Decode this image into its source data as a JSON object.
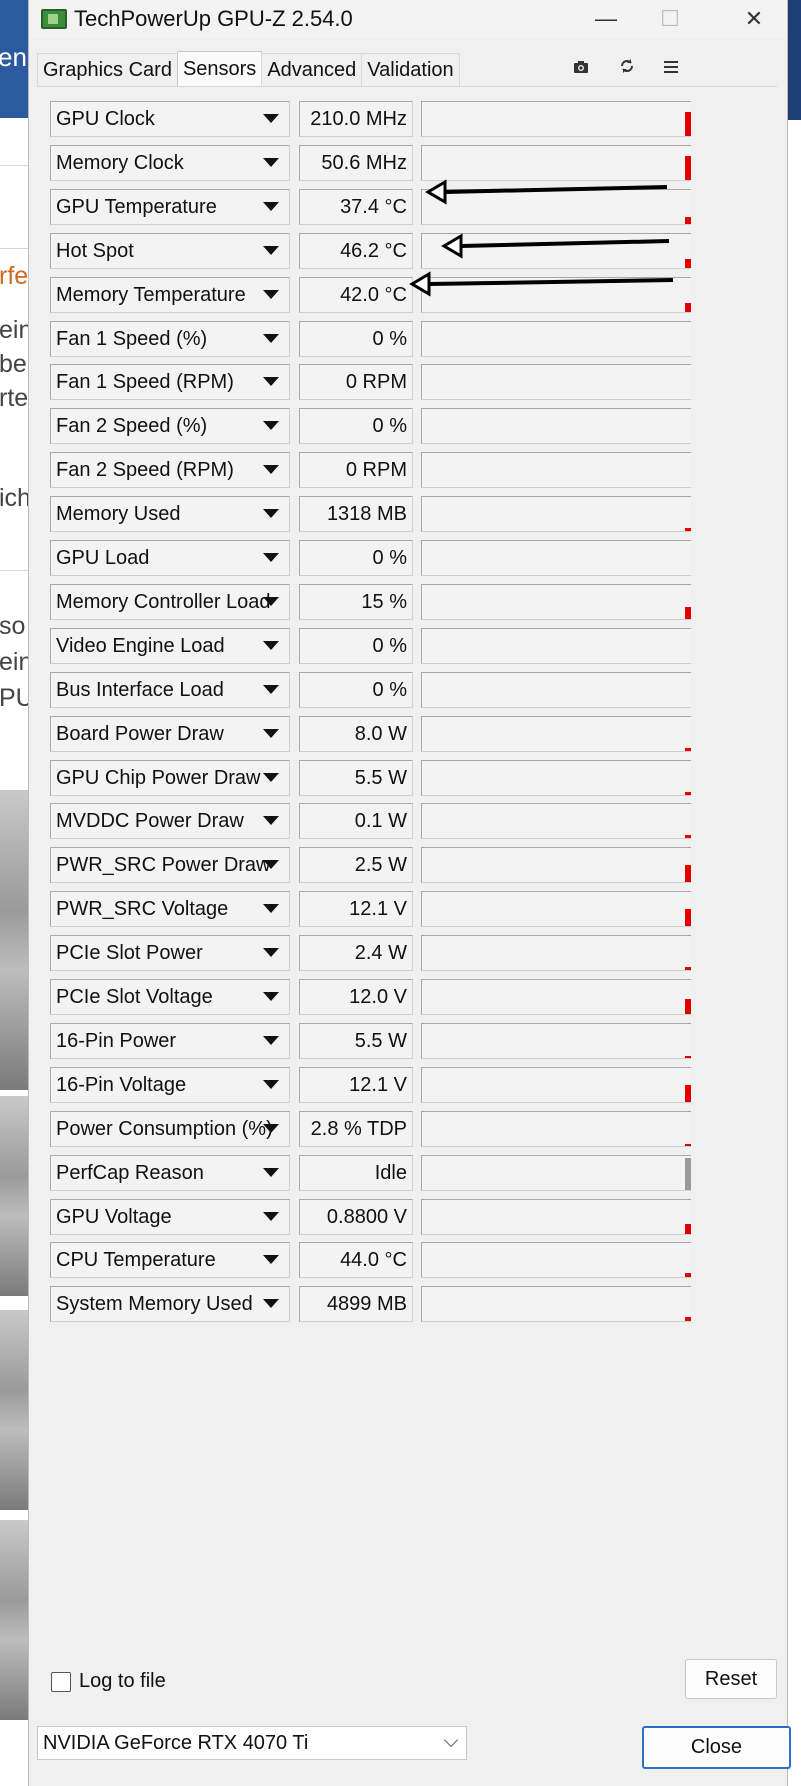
{
  "window": {
    "title": "TechPowerUp GPU-Z 2.54.0",
    "minimize": "—",
    "maximize": "☐",
    "close": "✕"
  },
  "tabs": [
    "Graphics Card",
    "Sensors",
    "Advanced",
    "Validation"
  ],
  "active_tab": "Sensors",
  "toolbar_icons": [
    "camera-icon",
    "refresh-icon",
    "menu-icon"
  ],
  "sensors": [
    {
      "name": "GPU Clock",
      "value": "210.0 MHz",
      "level": 0.7
    },
    {
      "name": "Memory Clock",
      "value": "50.6 MHz",
      "level": 0.7
    },
    {
      "name": "GPU Temperature",
      "value": "37.4 °C",
      "level": 0.2
    },
    {
      "name": "Hot Spot",
      "value": "46.2 °C",
      "level": 0.25
    },
    {
      "name": "Memory Temperature",
      "value": "42.0 °C",
      "level": 0.25
    },
    {
      "name": "Fan 1 Speed (%)",
      "value": "0 %",
      "level": 0
    },
    {
      "name": "Fan 1 Speed (RPM)",
      "value": "0 RPM",
      "level": 0
    },
    {
      "name": "Fan 2 Speed (%)",
      "value": "0 %",
      "level": 0
    },
    {
      "name": "Fan 2 Speed (RPM)",
      "value": "0 RPM",
      "level": 0
    },
    {
      "name": "Memory Used",
      "value": "1318 MB",
      "level": 0.08
    },
    {
      "name": "GPU Load",
      "value": "0 %",
      "level": 0
    },
    {
      "name": "Memory Controller Load",
      "value": "15 %",
      "level": 0.35
    },
    {
      "name": "Video Engine Load",
      "value": "0 %",
      "level": 0
    },
    {
      "name": "Bus Interface Load",
      "value": "0 %",
      "level": 0
    },
    {
      "name": "Board Power Draw",
      "value": "8.0 W",
      "level": 0.1
    },
    {
      "name": "GPU Chip Power Draw",
      "value": "5.5 W",
      "level": 0.1
    },
    {
      "name": "MVDDC Power Draw",
      "value": "0.1 W",
      "level": 0.08
    },
    {
      "name": "PWR_SRC Power Draw",
      "value": "2.5 W",
      "level": 0.5
    },
    {
      "name": "PWR_SRC Voltage",
      "value": "12.1 V",
      "level": 0.5
    },
    {
      "name": "PCIe Slot Power",
      "value": "2.4 W",
      "level": 0.1
    },
    {
      "name": "PCIe Slot Voltage",
      "value": "12.0 V",
      "level": 0.45
    },
    {
      "name": "16-Pin Power",
      "value": "5.5 W",
      "level": 0.06
    },
    {
      "name": "16-Pin Voltage",
      "value": "12.1 V",
      "level": 0.5
    },
    {
      "name": "Power Consumption (%)",
      "value": "2.8 % TDP",
      "level": 0.05
    },
    {
      "name": "PerfCap Reason",
      "value": "Idle",
      "level": 0.95,
      "color": "#9a9a9a"
    },
    {
      "name": "GPU Voltage",
      "value": "0.8800 V",
      "level": 0.3
    },
    {
      "name": "CPU Temperature",
      "value": "44.0 °C",
      "level": 0.12
    },
    {
      "name": "System Memory Used",
      "value": "4899 MB",
      "level": 0.12
    }
  ],
  "log_to_file": {
    "label": "Log to file",
    "checked": false
  },
  "reset_label": "Reset",
  "gpu_select": {
    "value": "NVIDIA GeForce RTX 4070 Ti"
  },
  "close_label": "Close",
  "background_page": {
    "words": [
      "en",
      "rfe",
      "ein",
      "be",
      "rte",
      "ich",
      "so",
      "ein",
      "PU"
    ]
  }
}
